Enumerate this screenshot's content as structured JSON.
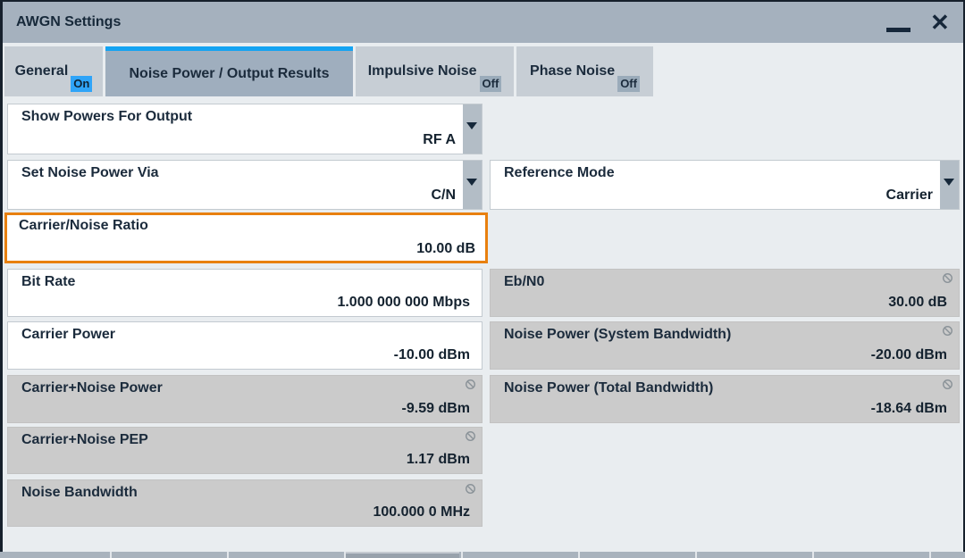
{
  "window": {
    "title": "AWGN Settings",
    "close_glyph": "✕"
  },
  "tabs": [
    {
      "label": "General",
      "badge": "On",
      "state": "on",
      "active": false
    },
    {
      "label": "Noise Power / Output Results",
      "badge": "",
      "state": "",
      "active": true
    },
    {
      "label": "Impulsive Noise",
      "badge": "Off",
      "state": "off",
      "active": false
    },
    {
      "label": "Phase Noise",
      "badge": "Off",
      "state": "off",
      "active": false
    }
  ],
  "fields": {
    "show_powers_for_output": {
      "label": "Show Powers For Output",
      "value": "RF A",
      "type": "dropdown",
      "editable": true
    },
    "set_noise_power_via": {
      "label": "Set Noise Power Via",
      "value": "C/N",
      "type": "dropdown",
      "editable": true
    },
    "reference_mode": {
      "label": "Reference Mode",
      "value": "Carrier",
      "type": "dropdown",
      "editable": true
    },
    "carrier_noise_ratio": {
      "label": "Carrier/Noise Ratio",
      "value": "10.00 dB",
      "type": "entry",
      "editable": true,
      "focused": true
    },
    "bit_rate": {
      "label": "Bit Rate",
      "value": "1.000 000 000 Mbps",
      "type": "entry",
      "editable": true
    },
    "eb_n0": {
      "label": "Eb/N0",
      "value": "30.00 dB",
      "type": "display",
      "editable": false
    },
    "carrier_power": {
      "label": "Carrier Power",
      "value": "-10.00 dBm",
      "type": "entry",
      "editable": true
    },
    "noise_power_system_bandwidth": {
      "label": "Noise Power (System Bandwidth)",
      "value": "-20.00 dBm",
      "type": "display",
      "editable": false
    },
    "carrier_noise_power": {
      "label": "Carrier+Noise Power",
      "value": "-9.59 dBm",
      "type": "display",
      "editable": false
    },
    "noise_power_total_bandwidth": {
      "label": "Noise Power (Total Bandwidth)",
      "value": "-18.64 dBm",
      "type": "display",
      "editable": false
    },
    "carrier_noise_pep": {
      "label": "Carrier+Noise PEP",
      "value": "1.17 dBm",
      "type": "display",
      "editable": false
    },
    "noise_bandwidth": {
      "label": "Noise Bandwidth",
      "value": "100.000 0 MHz",
      "type": "display",
      "editable": false
    }
  },
  "icons": {
    "minimize": "horizontal-bar",
    "close": "✕",
    "dropdown_arrow": "down-triangle",
    "readonly": "prohibition-circle"
  },
  "colors": {
    "accent_blue": "#14A3F2",
    "on_badge_blue": "#2FA4F8",
    "focus_orange": "#E8800F",
    "titlebar_grey": "#A5B1BE",
    "readonly_grey": "#CBCBCB",
    "text_dark": "#1B2B3C"
  }
}
